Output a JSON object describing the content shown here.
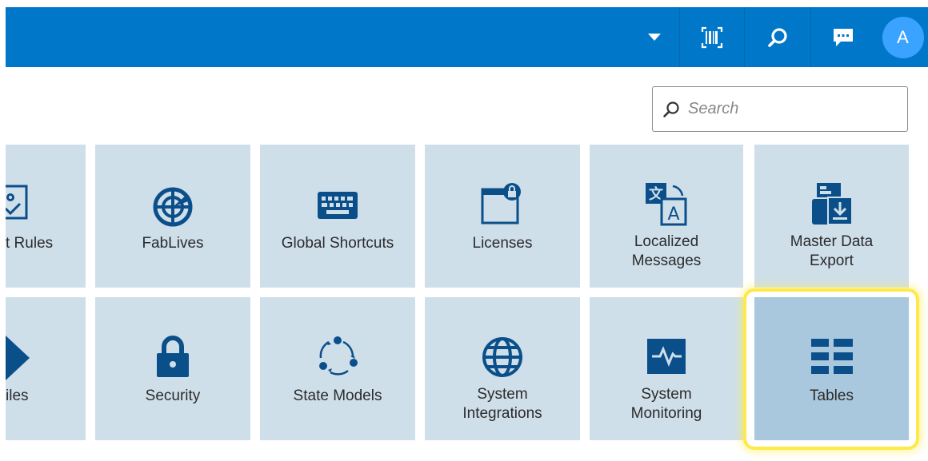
{
  "header": {
    "dropdown_icon": "caret-down-icon",
    "barcode_icon": "barcode-scan-icon",
    "search_icon": "search-icon",
    "chat_icon": "chat-icon",
    "avatar_initial": "A"
  },
  "search": {
    "placeholder": "Search",
    "value": ""
  },
  "tiles_row1": [
    {
      "label": "t Rules",
      "icon": "business-rules-icon"
    },
    {
      "label": "FabLives",
      "icon": "radar-icon"
    },
    {
      "label": "Global Shortcuts",
      "icon": "keyboard-icon"
    },
    {
      "label": "Licenses",
      "icon": "license-window-lock-icon"
    },
    {
      "label": "Localized\nMessages",
      "icon": "translate-icon"
    },
    {
      "label": "Master Data\nExport",
      "icon": "data-export-icon"
    }
  ],
  "tiles_row2": [
    {
      "label": "iles",
      "icon": "diamond-icon"
    },
    {
      "label": "Security",
      "icon": "lock-icon"
    },
    {
      "label": "State Models",
      "icon": "cycle-icon"
    },
    {
      "label": "System\nIntegrations",
      "icon": "globe-icon"
    },
    {
      "label": "System\nMonitoring",
      "icon": "pulse-monitor-icon"
    },
    {
      "label": "Tables",
      "icon": "table-icon",
      "selected": true
    }
  ],
  "colors": {
    "header": "#0077c8",
    "tile": "#cfdfea",
    "tile_selected": "#a9c8dd",
    "icon": "#0b4f8a",
    "highlight": "#ffe94a"
  }
}
